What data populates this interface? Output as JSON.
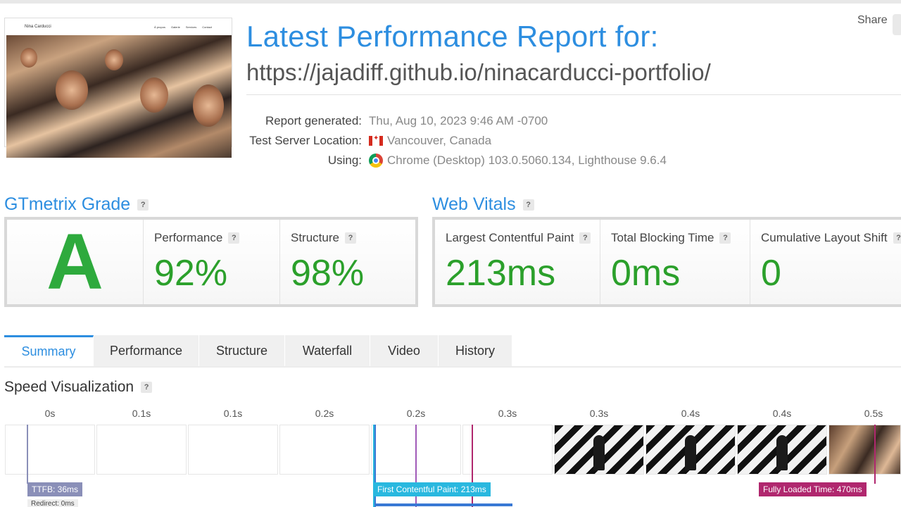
{
  "header": {
    "title": "Latest Performance Report for:",
    "url": "https://jajadiff.github.io/ninacarducci-portfolio/",
    "share_label": "Share",
    "thumbnail": {
      "site_name": "Nina Carducci",
      "nav_links": [
        "À propos",
        "Galerie",
        "Services",
        "Contact"
      ]
    }
  },
  "meta": {
    "report_generated_label": "Report generated:",
    "report_generated_value": "Thu, Aug 10, 2023 9:46 AM -0700",
    "location_label": "Test Server Location:",
    "location_value": "Vancouver, Canada",
    "location_icon": "canada-flag-icon",
    "using_label": "Using:",
    "using_value": "Chrome (Desktop) 103.0.5060.134, Lighthouse 9.6.4",
    "using_icon": "chrome-icon"
  },
  "grade": {
    "heading": "GTmetrix Grade",
    "help": "?",
    "letter": "A",
    "performance_label": "Performance",
    "performance_value": "92%",
    "structure_label": "Structure",
    "structure_value": "98%"
  },
  "vitals": {
    "heading": "Web Vitals",
    "help": "?",
    "lcp_label": "Largest Contentful Paint",
    "lcp_value": "213ms",
    "tbt_label": "Total Blocking Time",
    "tbt_value": "0ms",
    "cls_label": "Cumulative Layout Shift",
    "cls_value": "0"
  },
  "tabs": [
    "Summary",
    "Performance",
    "Structure",
    "Waterfall",
    "Video",
    "History"
  ],
  "active_tab": "Summary",
  "speed": {
    "heading": "Speed Visualization",
    "help": "?",
    "frame_times": [
      "0s",
      "0.1s",
      "0.1s",
      "0.2s",
      "0.2s",
      "0.3s",
      "0.3s",
      "0.4s",
      "0.4s",
      "0.5s"
    ],
    "ttfb_label": "TTFB: 36ms",
    "redirect_label": "Redirect: 0ms",
    "fcp_label": "First Contentful Paint: 213ms",
    "fully_loaded_label": "Fully Loaded Time: 470ms"
  },
  "colors": {
    "accent": "#2d8ee0",
    "grade_green": "#2eaa3d",
    "ttfb": "#8a8fb8",
    "fcp": "#29b8df",
    "fully_loaded": "#b0276e"
  }
}
